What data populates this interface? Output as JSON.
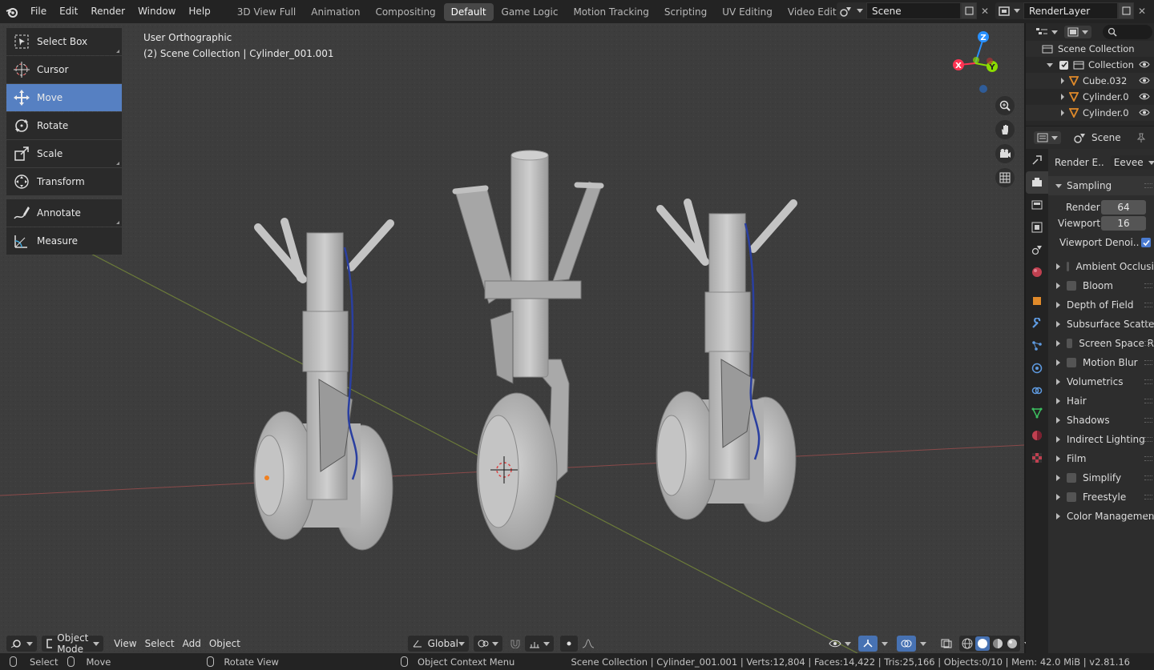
{
  "topbar": {
    "menus": [
      "File",
      "Edit",
      "Render",
      "Window",
      "Help"
    ],
    "workspaces": [
      {
        "label": "3D View Full",
        "active": false
      },
      {
        "label": "Animation",
        "active": false
      },
      {
        "label": "Compositing",
        "active": false
      },
      {
        "label": "Default",
        "active": true
      },
      {
        "label": "Game Logic",
        "active": false
      },
      {
        "label": "Motion Tracking",
        "active": false
      },
      {
        "label": "Scripting",
        "active": false
      },
      {
        "label": "UV Editing",
        "active": false
      },
      {
        "label": "Video Editing",
        "active": false
      }
    ],
    "add_workspace": "+",
    "scene": "Scene",
    "view_layer": "RenderLayer"
  },
  "toolbar": {
    "tools": [
      {
        "label": "Select Box",
        "icon": "select-box-icon",
        "active": false
      },
      {
        "label": "Cursor",
        "icon": "cursor-icon",
        "active": false
      },
      {
        "label": "Move",
        "icon": "move-icon",
        "active": true
      },
      {
        "label": "Rotate",
        "icon": "rotate-icon",
        "active": false
      },
      {
        "label": "Scale",
        "icon": "scale-icon",
        "active": false
      },
      {
        "label": "Transform",
        "icon": "transform-icon",
        "active": false
      },
      {
        "label": "Annotate",
        "icon": "annotate-icon",
        "active": false
      },
      {
        "label": "Measure",
        "icon": "measure-icon",
        "active": false
      }
    ]
  },
  "viewport": {
    "view_name": "User Orthographic",
    "context": "(2) Scene Collection | Cylinder_001.001",
    "gizmo_axes": {
      "x": "X",
      "y": "Y",
      "z": "Z"
    }
  },
  "header": {
    "mode": "Object Mode",
    "menus": [
      "View",
      "Select",
      "Add",
      "Object"
    ],
    "orientation": "Global"
  },
  "statusbar": {
    "select": "Select",
    "move": "Move",
    "rotate": "Rotate View",
    "context_menu": "Object Context Menu",
    "stats": "Scene Collection | Cylinder_001.001 | Verts:12,804 | Faces:14,422 | Tris:25,166 | Objects:0/10 | Mem: 42.0 MiB | v2.81.16"
  },
  "outliner": {
    "root": "Scene Collection",
    "collection": "Collection",
    "items": [
      "Cube.032",
      "Cylinder.0",
      "Cylinder.0"
    ]
  },
  "properties": {
    "title": "Scene",
    "render_engine_label": "Render E..",
    "render_engine": "Eevee",
    "sampling_label": "Sampling",
    "render_label": "Render",
    "render_samples": "64",
    "viewport_label": "Viewport",
    "viewport_samples": "16",
    "viewport_denoise": "Viewport Denoi..",
    "panels": [
      {
        "label": "Ambient Occlusi",
        "checkbox": true
      },
      {
        "label": "Bloom",
        "checkbox": true
      },
      {
        "label": "Depth of Field",
        "checkbox": false
      },
      {
        "label": "Subsurface Scatteri",
        "checkbox": false
      },
      {
        "label": "Screen Space R",
        "checkbox": true
      },
      {
        "label": "Motion Blur",
        "checkbox": true
      },
      {
        "label": "Volumetrics",
        "checkbox": false
      },
      {
        "label": "Hair",
        "checkbox": false
      },
      {
        "label": "Shadows",
        "checkbox": false
      },
      {
        "label": "Indirect Lighting",
        "checkbox": false
      },
      {
        "label": "Film",
        "checkbox": false
      },
      {
        "label": "Simplify",
        "checkbox": true
      },
      {
        "label": "Freestyle",
        "checkbox": true
      },
      {
        "label": "Color Management",
        "checkbox": false
      }
    ]
  },
  "colors": {
    "accent": "#5680c2",
    "axis_x": "#ff3352",
    "axis_y": "#8bdc00",
    "axis_z": "#2890ff"
  }
}
